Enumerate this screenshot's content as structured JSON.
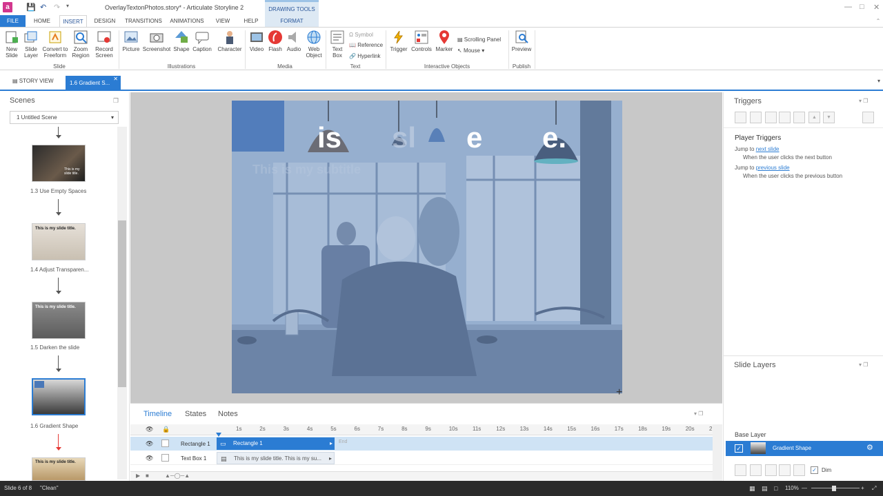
{
  "titlebar": {
    "doc_title": "OverlayTextonPhotos.story* - Articulate Storyline 2",
    "context_label": "DRAWING TOOLS",
    "app_icon_letter": "a"
  },
  "tabs": [
    "FILE",
    "HOME",
    "INSERT",
    "DESIGN",
    "TRANSITIONS",
    "ANIMATIONS",
    "VIEW",
    "HELP",
    "FORMAT"
  ],
  "ribbon": {
    "slide_group": {
      "label": "Slide",
      "buttons": [
        "New Slide",
        "Slide Layer",
        "Convert to Freeform",
        "Zoom Region",
        "Record Screen"
      ]
    },
    "illustrations_group": {
      "label": "Illustrations",
      "buttons": [
        "Picture",
        "Screenshot",
        "Shape",
        "Caption",
        "Character"
      ]
    },
    "media_group": {
      "label": "Media",
      "buttons": [
        "Video",
        "Flash",
        "Audio",
        "Web Object"
      ]
    },
    "text_group": {
      "label": "Text",
      "buttons": [
        "Text Box"
      ],
      "small": [
        "Symbol",
        "Reference",
        "Hyperlink"
      ]
    },
    "interactive_group": {
      "label": "Interactive Objects",
      "buttons": [
        "Trigger",
        "Controls",
        "Marker"
      ],
      "small": [
        "Scrolling Panel",
        "Mouse"
      ]
    },
    "publish_group": {
      "label": "Publish",
      "buttons": [
        "Preview"
      ]
    }
  },
  "story_tabs": {
    "story_view": "STORY VIEW",
    "slide_tab": "1.6 Gradient S..."
  },
  "scenes": {
    "title": "Scenes",
    "selected_scene": "1 Untitled Scene",
    "thumbnails": [
      {
        "label": "1.3 Use Empty Spaces",
        "caption": "This is my slide title."
      },
      {
        "label": "1.4 Adjust Transparen...",
        "caption": "This is my slide title."
      },
      {
        "label": "1.5 Darken the slide",
        "caption": "This is my slide title."
      },
      {
        "label": "1.6 Gradient Shape",
        "caption": ""
      },
      {
        "label": "",
        "caption": "This is my slide title."
      }
    ]
  },
  "slide": {
    "title_fragment_1": "is",
    "title_fragment_2": "sl",
    "title_fragment_3": "e",
    "title_fragment_4": "e.",
    "subtitle_fragment": "This is my subtitle",
    "overlay_color": "#7e9bc4",
    "accent_block_color": "#4a78b8"
  },
  "timeline": {
    "tabs": [
      "Timeline",
      "States",
      "Notes"
    ],
    "ruler": [
      "1s",
      "2s",
      "3s",
      "4s",
      "5s",
      "6s",
      "7s",
      "8s",
      "9s",
      "10s",
      "11s",
      "12s",
      "13s",
      "14s",
      "15s",
      "16s",
      "17s",
      "18s",
      "19s",
      "20s",
      "2"
    ],
    "rows": [
      {
        "name": "Rectangle 1",
        "bar_text": "Rectangle 1",
        "end_label": "End"
      },
      {
        "name": "Text Box 1",
        "bar_text": "This is my slide title. This is my su..."
      }
    ]
  },
  "triggers": {
    "title": "Triggers",
    "section": "Player Triggers",
    "items": [
      {
        "prefix": "Jump to ",
        "link": "next slide",
        "condition": "When the user clicks the next button"
      },
      {
        "prefix": "Jump to ",
        "link": "previous slide",
        "condition": "When the user clicks the previous button"
      }
    ]
  },
  "layers": {
    "title": "Slide Layers",
    "base_layer_label": "Base Layer",
    "layer_name": "Gradient Shape",
    "dim_label": "Dim"
  },
  "status": {
    "slide_info": "Slide 6 of 8",
    "theme": "\"Clean\"",
    "zoom": "110%"
  },
  "colors": {
    "accent": "#2b7cd3",
    "file_tab": "#2b7cd3"
  }
}
